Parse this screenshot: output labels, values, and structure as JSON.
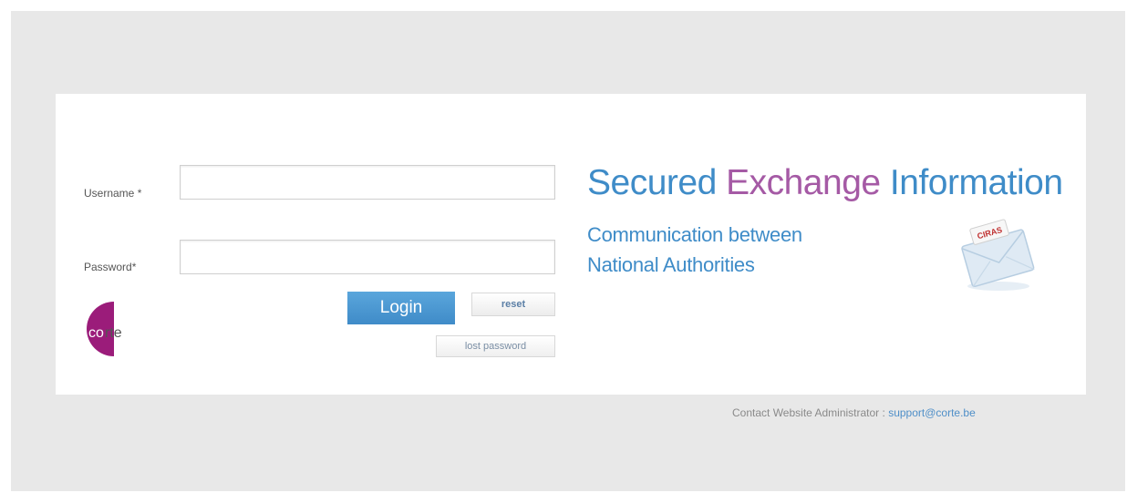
{
  "form": {
    "username_label": "Username *",
    "username_value": "",
    "password_label": "Password*",
    "password_value": "",
    "login_label": "Login",
    "reset_label": "reset",
    "lost_password_label": "lost password"
  },
  "logo": {
    "text": "corte",
    "accent_color": "#9b1c7a"
  },
  "hero": {
    "title_part1": "Secured ",
    "title_part2": "Exchange",
    "title_part3": " Information",
    "subtitle_line1": "Communication between",
    "subtitle_line2": "National Authorities",
    "envelope_badge": "CIRAS",
    "blue_color": "#3f8cc8",
    "purple_color": "#a55aa5"
  },
  "footer": {
    "contact_label": "Contact Website Administrator :",
    "contact_email": "support@corte.be"
  },
  "icons": [
    "envelope-icon",
    "corte-logo"
  ]
}
